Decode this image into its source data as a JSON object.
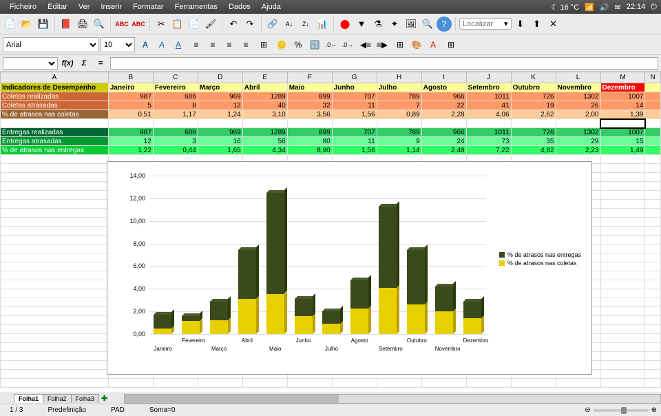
{
  "menubar": {
    "items": [
      "Ficheiro",
      "Editar",
      "Ver",
      "Inserir",
      "Formatar",
      "Ferramentas",
      "Dados",
      "Ajuda"
    ],
    "systray": {
      "temp": "16 °C",
      "time": "22:14"
    }
  },
  "toolbar": {
    "find_label": "Localizar"
  },
  "formatbar": {
    "font": "Arial",
    "size": "10"
  },
  "formula_bar": {
    "cell_ref": "",
    "formula": ""
  },
  "columns": [
    "A",
    "B",
    "C",
    "D",
    "E",
    "F",
    "G",
    "H",
    "I",
    "J",
    "K",
    "L",
    "M",
    "N"
  ],
  "months": [
    "Janeiro",
    "Fevereiro",
    "Março",
    "Abril",
    "Maio",
    "Junho",
    "Julho",
    "Agosto",
    "Setembro",
    "Outubro",
    "Novembro",
    "Dezembro"
  ],
  "rows": {
    "header_label": "Indicadores de Desempenho",
    "coletas_realizadas": {
      "label": "Coletas realizadas",
      "values": [
        987,
        686,
        969,
        1289,
        899,
        707,
        789,
        966,
        1011,
        726,
        1302,
        1007
      ]
    },
    "coletas_atrasadas": {
      "label": "Coletas atrasadas",
      "values": [
        5,
        8,
        12,
        40,
        32,
        11,
        7,
        22,
        41,
        19,
        26,
        14
      ]
    },
    "pct_atrasos_coletas": {
      "label": "% de atrasos nas coletas",
      "values": [
        "0,51",
        "1,17",
        "1,24",
        "3,10",
        "3,56",
        "1,56",
        "0,89",
        "2,28",
        "4,06",
        "2,62",
        "2,00",
        "1,39"
      ]
    },
    "entregas_realizadas": {
      "label": "Entregas realizadas",
      "values": [
        987,
        686,
        969,
        1289,
        899,
        707,
        789,
        966,
        1011,
        726,
        1302,
        1007
      ]
    },
    "entregas_atrasadas": {
      "label": "Entregas atrasadas",
      "values": [
        12,
        3,
        16,
        56,
        80,
        11,
        9,
        24,
        73,
        35,
        29,
        15
      ]
    },
    "pct_atrasos_entregas": {
      "label": "% de atrasos nas entregas",
      "values": [
        "1,22",
        "0,44",
        "1,65",
        "4,34",
        "8,90",
        "1,56",
        "1,14",
        "2,48",
        "7,22",
        "4,82",
        "2,23",
        "1,49"
      ]
    }
  },
  "chart_data": {
    "type": "bar",
    "stacked": true,
    "categories": [
      "Janeiro",
      "Fevereiro",
      "Março",
      "Abril",
      "Maio",
      "Junho",
      "Julho",
      "Agosto",
      "Setembro",
      "Outubro",
      "Novembro",
      "Dezembro"
    ],
    "series": [
      {
        "name": "% de atrasos nas entregas",
        "color": "#3a4a1a",
        "values": [
          1.22,
          0.44,
          1.65,
          4.34,
          8.9,
          1.56,
          1.14,
          2.48,
          7.22,
          4.82,
          2.23,
          1.49
        ]
      },
      {
        "name": "% de atrasos nas coletas",
        "color": "#e8d000",
        "values": [
          0.51,
          1.17,
          1.24,
          3.1,
          3.56,
          1.56,
          0.89,
          2.28,
          4.06,
          2.62,
          2.0,
          1.39
        ]
      }
    ],
    "ylim": [
      0,
      14
    ],
    "yticks": [
      "0,00",
      "2,00",
      "4,00",
      "6,00",
      "8,00",
      "10,00",
      "12,00",
      "14,00"
    ]
  },
  "tabs": {
    "sheets": [
      "Folha1",
      "Folha2",
      "Folha3"
    ],
    "active": 0
  },
  "statusbar": {
    "sheet_pos": "1 / 3",
    "style": "Predefinição",
    "insert_mode": "PAD",
    "sum": "Soma=0",
    "zoom_minus": "⊖",
    "zoom_plus": "⊕"
  }
}
